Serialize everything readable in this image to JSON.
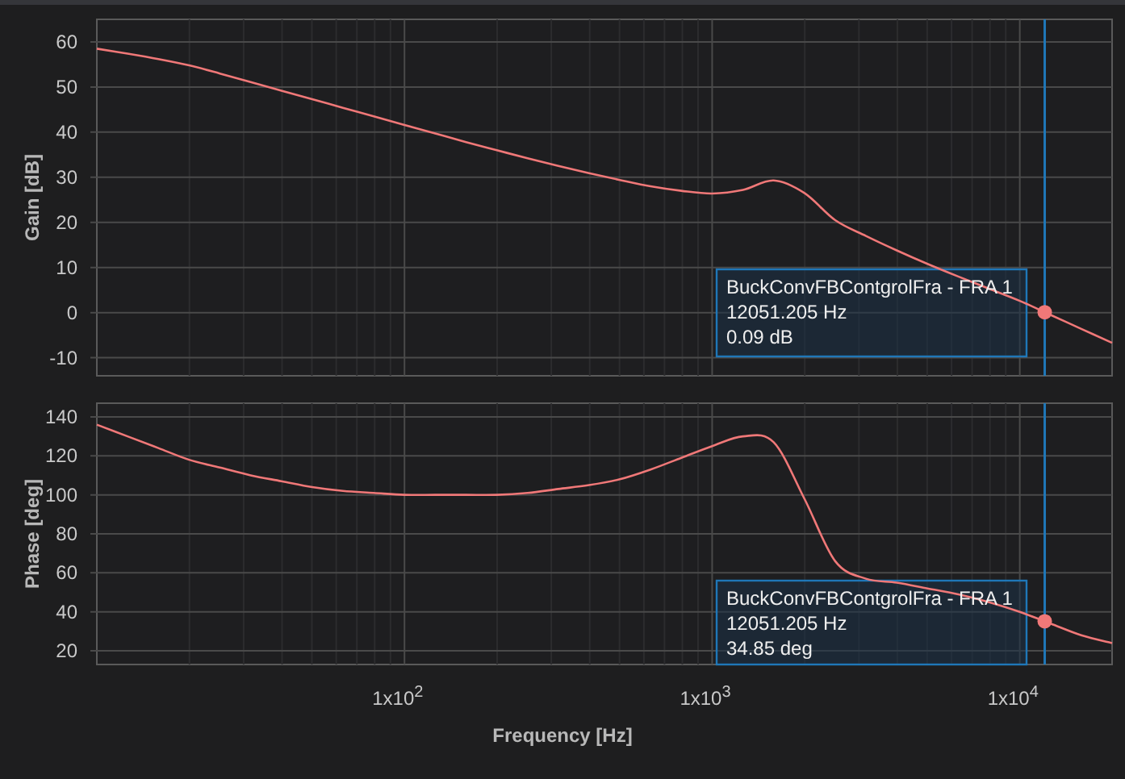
{
  "gain_panel": {
    "chart_data": {
      "type": "line",
      "ylabel": "Gain [dB]",
      "ylim": [
        -14,
        65
      ],
      "yticks": [
        -10,
        0,
        10,
        20,
        30,
        40,
        50,
        60
      ],
      "grid": true,
      "series": [
        {
          "name": "BuckConvFBContgrolFra - FRA 1",
          "color": "#f07878",
          "values": [
            58.5,
            57.4,
            56.2,
            54.8,
            53,
            51.1,
            49.2,
            47.3,
            45.4,
            43.5,
            41.6,
            39.7,
            37.8,
            36,
            34.2,
            32.5,
            30.9,
            29.4,
            28,
            27,
            26.4,
            27.2,
            29.3,
            26.5,
            20.5,
            17,
            13.8,
            10.8,
            8,
            5.3,
            2.6,
            -0.5,
            -3.6,
            -6.7
          ]
        }
      ]
    },
    "tooltip": {
      "lines": [
        "12051.205 Hz",
        "0.09  dB"
      ]
    }
  },
  "phase_panel": {
    "chart_data": {
      "type": "line",
      "xlabel": "Frequency [Hz]",
      "ylabel": "Phase [deg]",
      "ylim": [
        13,
        147
      ],
      "yticks": [
        20,
        40,
        60,
        80,
        100,
        120,
        140
      ],
      "grid": true,
      "categories": [
        null,
        null,
        null,
        null,
        null,
        null,
        null,
        null,
        null,
        null,
        "1x10$^{2}$",
        null,
        null,
        null,
        null,
        null,
        null,
        null,
        null,
        null,
        "1x10$^{3}$",
        null,
        null,
        null,
        null,
        null,
        null,
        null,
        null,
        null,
        "1x10$^{4}$",
        null,
        null,
        null
      ],
      "series": [
        {
          "name": "BuckConvFBContgrolFra - FRA 1",
          "color": "#f07878",
          "values": [
            136,
            130,
            124,
            118,
            114,
            110,
            107,
            104,
            102,
            101,
            100,
            100,
            100,
            100,
            101,
            103,
            105,
            108,
            113,
            119,
            125,
            130,
            127,
            98,
            66,
            57,
            55,
            52,
            49,
            45,
            40,
            34,
            28,
            24
          ]
        }
      ]
    },
    "tooltip": {
      "lines": [
        "12051.205 Hz",
        "34.85  deg"
      ]
    }
  }
}
